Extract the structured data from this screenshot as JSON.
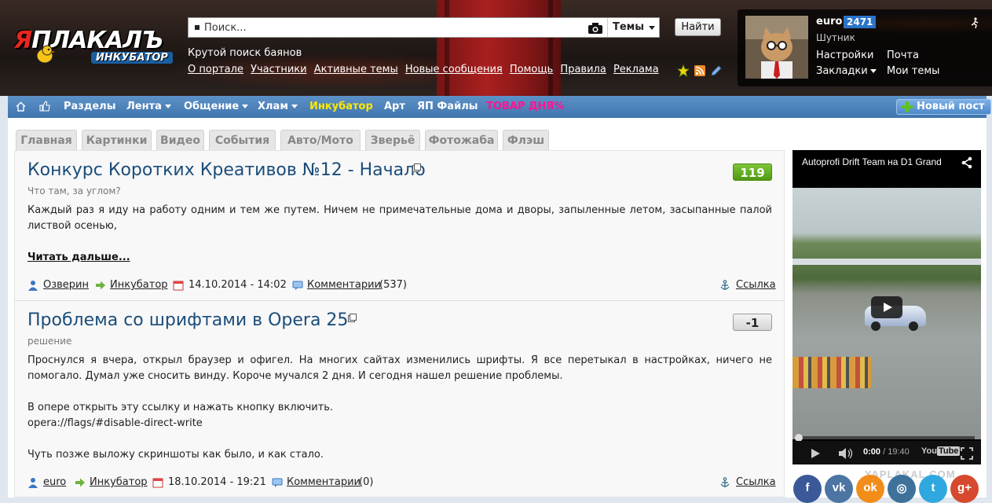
{
  "logo": {
    "main_ya": "Я",
    "main_rest": "ПЛАКАЛЪ",
    "sub": "ИНКУБАТОР"
  },
  "search": {
    "placeholder": "Поиск...",
    "scope": "Темы",
    "button": "Найти",
    "hint": "Крутой поиск баянов"
  },
  "top_links": [
    "О портале",
    "Участники",
    "Активные темы",
    "Новые сообщения",
    "Помощь",
    "Правила",
    "Реклама"
  ],
  "user": {
    "name": "euro",
    "karma": "2471",
    "rank": "Шутник",
    "settings": "Настройки",
    "mail": "Почта",
    "bookmarks": "Закладки",
    "my_topics": "Мои темы"
  },
  "nav": {
    "sections": "Разделы",
    "feed": "Лента",
    "social": "Общение",
    "junk": "Хлам",
    "incubator": "Инкубатор",
    "art": "Арт",
    "files": "ЯП Файлы",
    "product": "ТОВАР ДНЯ%",
    "new_post": "Новый пост"
  },
  "colors": {
    "incubator": "#ffe800",
    "product": "#ff1493",
    "score_pos": "#5aa51a",
    "title": "#1a4d7a"
  },
  "category_tabs": [
    "Главная",
    "Картинки",
    "Видео",
    "События",
    "Авто/Мото",
    "Зверьё",
    "Фотожаба",
    "Флэш"
  ],
  "posts": [
    {
      "title": "Конкурс Коротких Креативов №12 - Начало",
      "subtitle": "Что там, за углом?",
      "body": [
        "Каждый раз я иду на работу одним и тем же путем. Ничем не примечательные дома и дворы, запыленные летом, засыпанные палой листвой осенью,"
      ],
      "read_more": "Читать дальше...",
      "score": "119",
      "author": "Озверин",
      "section": "Инкубатор",
      "date": "14.10.2014 - 14:02",
      "comments_label": "Комментарии",
      "comments_count": "(537)",
      "link": "Ссылка"
    },
    {
      "title": "Проблема со шрифтами в Opera 25",
      "subtitle": "решение",
      "body": [
        "Проснулся я вчера, открыл браузер и офигел. На многих сайтах изменились шрифты. Я все перетыкал в настройках, ничего не помогало. Думал уже сносить винду. Короче мучался 2 дня. И сегодня нашел решение проблемы.",
        "В опере открыть эту ссылку и нажать кнопку включить.",
        "opera://flags/#disable-direct-write",
        "Чуть позже выложу скриншоты как было, и как стало."
      ],
      "score": "-1",
      "author": "euro",
      "section": "Инкубатор",
      "date": "18.10.2014 - 19:21",
      "comments_label": "Комментарии",
      "comments_count": "(0)",
      "link": "Ссылка"
    }
  ],
  "video": {
    "title": "Autoprofi Drift Team на D1 Grand",
    "current_time": "0:00",
    "separator": " / ",
    "total_time": "19:40",
    "logo_you": "You",
    "logo_tube": "Tube",
    "progress": 0
  },
  "watermark": "YAPLAKAL.COM",
  "social_icons": [
    {
      "icon": "facebook-icon",
      "glyph": "f",
      "color": "#3b5998"
    },
    {
      "icon": "vkontakte-icon",
      "glyph": "vk",
      "color": "#4c75a3"
    },
    {
      "icon": "odnoklassniki-icon",
      "glyph": "ok",
      "color": "#f28d1a"
    },
    {
      "icon": "instagram-icon",
      "glyph": "◎",
      "color": "#3f729b"
    },
    {
      "icon": "twitter-icon",
      "glyph": "t",
      "color": "#2fa8e0"
    },
    {
      "icon": "googleplus-icon",
      "glyph": "g+",
      "color": "#d6492f"
    }
  ]
}
